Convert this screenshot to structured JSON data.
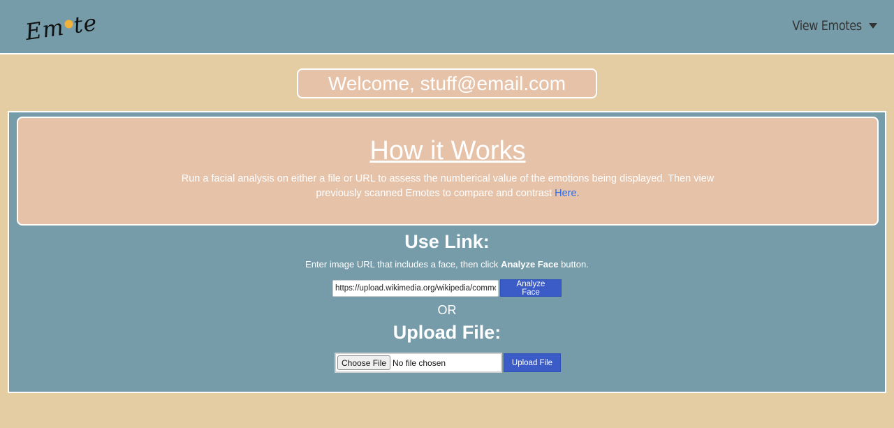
{
  "nav": {
    "logo_left": "Em",
    "logo_right": "te",
    "dropdown_label": "View Emotes"
  },
  "welcome": {
    "text": "Welcome, stuff@email.com"
  },
  "how_it_works": {
    "title": "How it Works",
    "description": "Run a facial analysis on either a file or URL to assess the numberical value of the emotions being displayed. Then view previously scanned Emotes to compare and contrast",
    "link_text": "Here."
  },
  "use_link": {
    "title": "Use Link:",
    "desc_prefix": "Enter image URL that includes a face, then click",
    "desc_bold": "Analyze Face",
    "desc_suffix": "button.",
    "url_value": "https://upload.wikimedia.org/wikipedia/commons/",
    "analyze_label": "Analyze Face"
  },
  "or_text": "OR",
  "upload": {
    "title": "Upload File:",
    "choose_label": "Choose File",
    "no_file_text": "No file chosen",
    "upload_label": "Upload File"
  },
  "colors": {
    "background": "#E5CDA3",
    "panel": "#769CAA",
    "card": "#E6C2A8",
    "button": "#3B5CC6",
    "link": "#2B6DEB"
  }
}
